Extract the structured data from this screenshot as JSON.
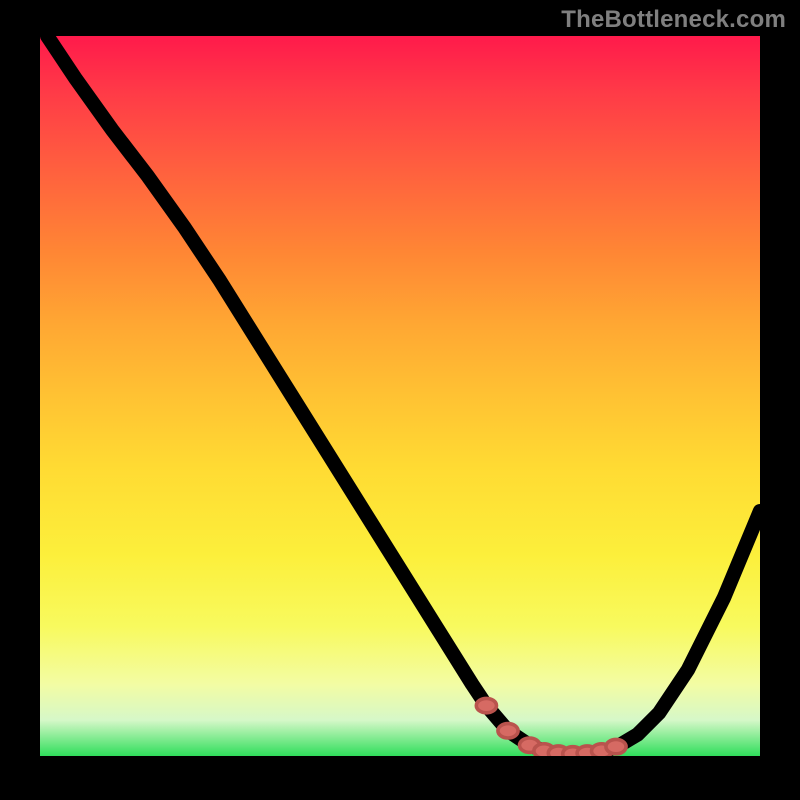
{
  "watermark": "TheBottleneck.com",
  "colors": {
    "background": "#000000",
    "gradient_top": "#ff1a4b",
    "gradient_bottom": "#30de5b",
    "curve": "#000000",
    "markers": "#d66a63",
    "watermark_text": "#7f7f7f"
  },
  "chart_data": {
    "type": "line",
    "title": "",
    "xlabel": "",
    "ylabel": "",
    "xlim": [
      0,
      100
    ],
    "ylim": [
      0,
      100
    ],
    "grid": false,
    "legend": false,
    "series": [
      {
        "name": "bottleneck-curve",
        "x": [
          1,
          5,
          10,
          15,
          20,
          25,
          30,
          35,
          40,
          45,
          50,
          55,
          60,
          62,
          65,
          68,
          70,
          72,
          74,
          76,
          78,
          80,
          83,
          86,
          90,
          95,
          100
        ],
        "values": [
          100,
          94,
          87,
          80.5,
          73.5,
          66,
          58,
          50,
          42,
          34,
          26,
          18,
          10,
          7,
          3.5,
          1.5,
          0.7,
          0.3,
          0.2,
          0.3,
          0.6,
          1.2,
          3,
          6,
          12,
          22,
          34
        ]
      }
    ],
    "markers": {
      "name": "highlighted-range",
      "x": [
        62,
        65,
        68,
        70,
        72,
        74,
        76,
        78,
        80
      ],
      "values": [
        7,
        3.5,
        1.5,
        0.7,
        0.4,
        0.3,
        0.4,
        0.7,
        1.3
      ]
    }
  }
}
